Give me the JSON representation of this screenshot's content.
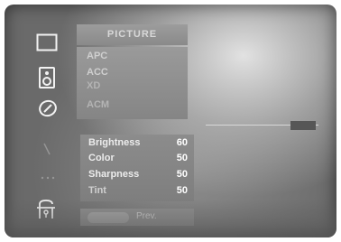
{
  "sidebar": {
    "icons": [
      "screen-icon",
      "speaker-icon",
      "timer-icon",
      "special-icon",
      "dots-icon",
      "lock-icon"
    ]
  },
  "menu": {
    "title": "PICTURE",
    "items": [
      "APC",
      "ACC",
      "XD",
      "ACM"
    ]
  },
  "adjust": {
    "rows": [
      {
        "label": "Brightness",
        "value": "60"
      },
      {
        "label": "Color",
        "value": "50"
      },
      {
        "label": "Sharpness",
        "value": "50"
      },
      {
        "label": "Tint",
        "value": "50"
      }
    ]
  },
  "footer": {
    "prev_label": "Prev."
  }
}
